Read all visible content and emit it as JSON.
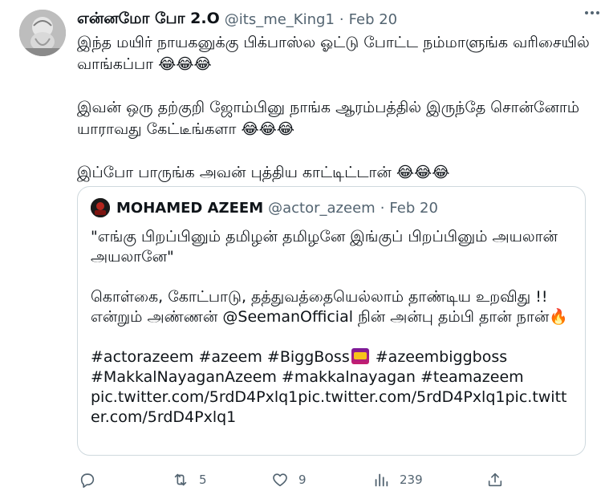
{
  "tweet": {
    "display_name": "என்னமோ போ 2.O",
    "handle": "@its_me_King1",
    "separator": "·",
    "time": "Feb 20",
    "paragraphs": [
      "இந்த மயிர் நாயகனுக்கு பிக்பாஸ்ல ஓட்டு போட்ட நம்மாளுங்க வரிசையில் வாங்கப்பா 😂😂😂",
      "இவன் ஒரு தற்குறி ஜோம்பினு நாங்க ஆரம்பத்தில் இருந்தே சொன்னோம் யாராவது கேட்டீங்களா 😂😂😂",
      "இப்போ பாருங்க அவன் புத்திய காட்டிட்டான் 😂😂😂"
    ]
  },
  "quote": {
    "display_name": "MOHAMED AZEEM",
    "handle": "@actor_azeem",
    "separator": "·",
    "time": "Feb 20",
    "p1": "\"எங்கு பிறப்பினும் தமிழன் தமிழனே இங்குப் பிறப்பினும் அயலான் அயலானே\"",
    "p2": "கொள்கை, கோட்பாடு, தத்துவத்தையெல்லாம் தாண்டிய உறவிது !! என்றும் அண்ணன் @SeemanOfficial நின் அன்பு தம்பி தான் நான்🔥",
    "hashtags_a": "#actorazeem  #azeem #BiggBoss",
    "hashtags_b": " #azeembiggboss",
    "hashtags_c": "#MakkalNayaganAzeem #makkalnayagan #teamazeem",
    "links": "pic.twitter.com/5rdD4Pxlq1pic.twitter.com/5rdD4Pxlq1pic.twitter.com/5rdD4Pxlq1"
  },
  "actions": {
    "replies": "",
    "retweets": "5",
    "likes": "9",
    "views": "239"
  },
  "icons": {
    "reply": "reply-icon",
    "retweet": "retweet-icon",
    "like": "heart-icon",
    "views": "views-icon",
    "share": "share-icon",
    "more": "more-icon"
  },
  "colors": {
    "text": "#0f1419",
    "secondary": "#536471",
    "border": "#cfd9de"
  }
}
